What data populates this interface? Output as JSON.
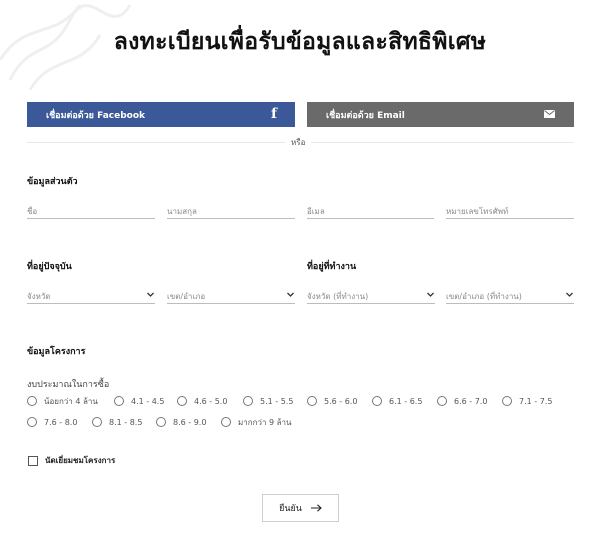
{
  "page": {
    "title": "ลงทะเบียนเพื่อรับข้อมูลและสิทธิพิเศษ"
  },
  "social": {
    "facebook_label": "เชื่อมต่อด้วย Facebook",
    "email_label": "เชื่อมต่อด้วย Email",
    "facebook_color": "#3b5998",
    "email_color": "#6a6a6a",
    "facebook_glyph": "f",
    "or_text": "หรือ"
  },
  "personal": {
    "heading": "ข้อมูลส่วนตัว",
    "fields": [
      {
        "placeholder": "ชื่อ"
      },
      {
        "placeholder": "นามสกุล"
      },
      {
        "placeholder": "อีเมล"
      },
      {
        "placeholder": "หมายเลขโทรศัพท์"
      }
    ]
  },
  "home_address": {
    "heading": "ที่อยู่ปัจจุบัน",
    "province": "จังหวัด",
    "district": "เขต/อำเภอ"
  },
  "work_address": {
    "heading": "ที่อยู่ที่ทำงาน",
    "province": "จังหวัด (ที่ทำงาน)",
    "district": "เขต/อำเภอ (ที่ทำงาน)"
  },
  "project": {
    "heading": "ข้อมูลโครงการ",
    "budget_label": "งบประมาณในการซื้อ",
    "budget_options": [
      "น้อยกว่า 4 ล้าน",
      "4.1 - 4.5",
      "4.6 - 5.0",
      "5.1 - 5.5",
      "5.6 - 6.0",
      "6.1 - 6.5",
      "6.6 - 7.0",
      "7.1 - 7.5",
      "7.6 - 8.0",
      "8.1 - 8.5",
      "8.6 - 9.0",
      "มากกว่า 9 ล้าน"
    ],
    "visit_label": "นัดเยี่ยมชมโครงการ"
  },
  "submit": {
    "label": "ยืนยัน"
  }
}
